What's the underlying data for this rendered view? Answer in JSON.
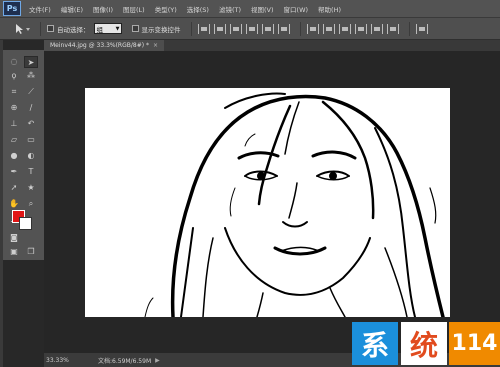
{
  "app": {
    "logo": "Ps"
  },
  "menu": [
    "文件(F)",
    "编辑(E)",
    "图像(I)",
    "图层(L)",
    "类型(Y)",
    "选择(S)",
    "滤镜(T)",
    "视图(V)",
    "窗口(W)",
    "帮助(H)"
  ],
  "options": {
    "auto_select_label": "自动选择：",
    "auto_select_value": "组",
    "show_transform_label": "显示变换控件"
  },
  "document": {
    "tab_title": "Meinv44.jpg @ 33.3%(RGB/8#) *",
    "close_glyph": "×"
  },
  "status": {
    "zoom": "33.33%",
    "doc_info": "文档:6.59M/6.59M",
    "arrow": "▶"
  },
  "colors": {
    "foreground": "#e01515",
    "background": "#ffffff"
  },
  "watermark": {
    "c1": "系",
    "c2": "统",
    "c3": "114"
  },
  "tools": [
    "marquee-icon",
    "move-icon",
    "lasso-icon",
    "magic-wand-icon",
    "crop-icon",
    "eyedropper-icon",
    "healing-brush-icon",
    "brush-icon",
    "clone-stamp-icon",
    "history-brush-icon",
    "eraser-icon",
    "gradient-icon",
    "blur-icon",
    "dodge-icon",
    "pen-icon",
    "type-icon",
    "path-selection-icon",
    "shape-icon",
    "hand-icon",
    "zoom-icon"
  ]
}
